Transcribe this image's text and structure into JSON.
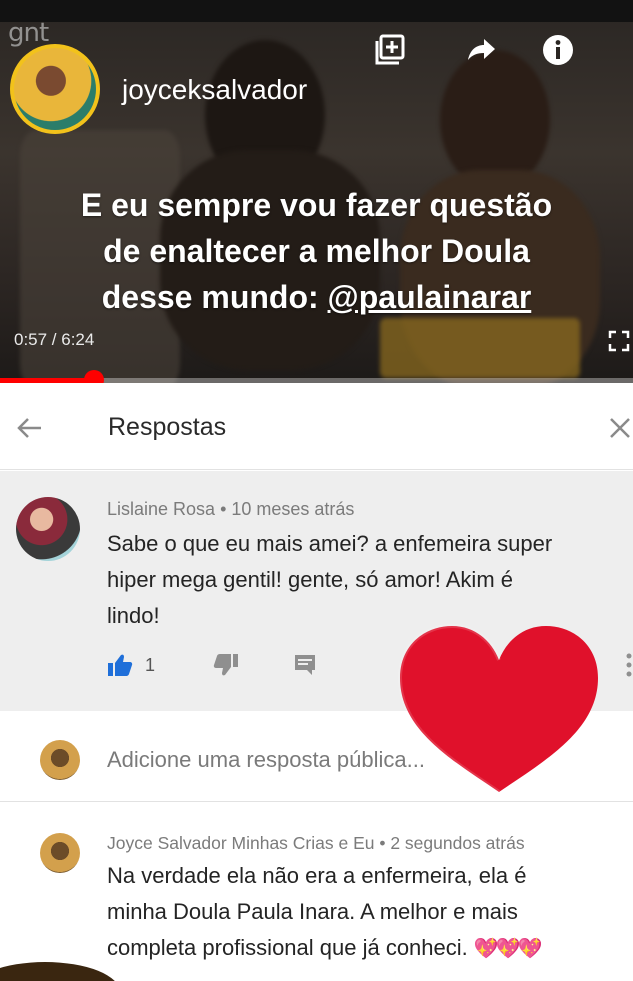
{
  "video": {
    "channel_logo": "gnt",
    "username": "joyceksalvador",
    "caption_lines": [
      "E eu sempre vou fazer questão",
      "de enaltecer a melhor Doula",
      "desse mundo: "
    ],
    "mention": "@paulainarar",
    "time": "0:57 / 6:24",
    "progress": 0.149,
    "icons": [
      "add-to-playlist-icon",
      "share-icon",
      "info-icon",
      "fullscreen-icon"
    ]
  },
  "panel": {
    "title": "Respostas",
    "back_icon": "back-arrow-icon",
    "close_icon": "close-icon"
  },
  "comment": {
    "author_meta": "Lislaine Rosa • 10 meses atrás",
    "text_lines": [
      "Sabe o que eu mais amei? a enfemeira super",
      "hiper mega gentil! gente, só amor! Akim é",
      "lindo!"
    ],
    "likes": "1"
  },
  "add_reply": {
    "placeholder": "Adicione uma resposta pública..."
  },
  "reply": {
    "author_meta": "Joyce Salvador Minhas Crias e Eu • 2 segundos atrás",
    "text_lines": [
      "Na verdade ela não era a enfermeira, ela é",
      "minha Doula Paula Inara. A melhor e mais",
      "completa profissional que já conheci. "
    ],
    "emoji": "💖💖💖"
  },
  "colors": {
    "accent": "#ff0000",
    "like_blue": "#1f6fd9",
    "heart_sticker": "#e0112b",
    "avatar_ring": "#f2c21b"
  }
}
